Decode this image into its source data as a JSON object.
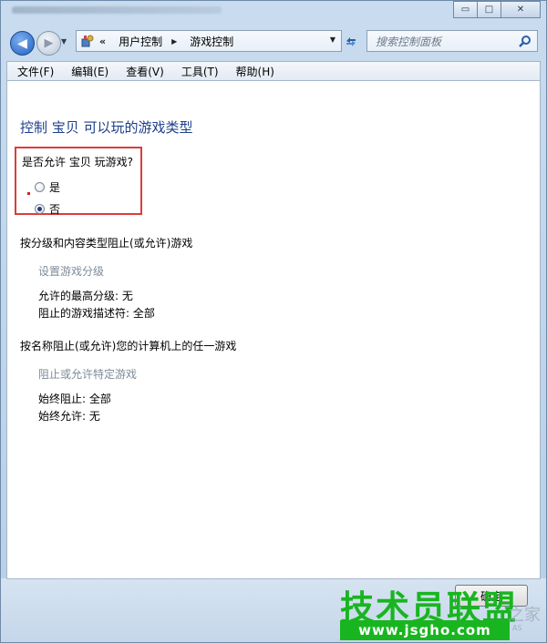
{
  "window": {
    "controls": {
      "minimize": "▭",
      "maximize": "□",
      "close": "✕"
    }
  },
  "nav": {
    "back_glyph": "◀",
    "forward_glyph": "▶",
    "breadcrumb_prefix": "«",
    "breadcrumbs": [
      "用户控制",
      "游戏控制"
    ],
    "search_placeholder": "搜索控制面板"
  },
  "menu": [
    "文件(F)",
    "编辑(E)",
    "查看(V)",
    "工具(T)",
    "帮助(H)"
  ],
  "main": {
    "heading": "控制 宝贝 可以玩的游戏类型",
    "question": "是否允许 宝贝 玩游戏?",
    "options": [
      {
        "label": "是",
        "selected": false
      },
      {
        "label": "否",
        "selected": true
      }
    ],
    "section1": {
      "title": "按分级和内容类型阻止(或允许)游戏",
      "link": "设置游戏分级",
      "info": [
        "允许的最高分级: 无",
        "阻止的游戏描述符: 全部"
      ]
    },
    "section2": {
      "title": "按名称阻止(或允许)您的计算机上的任一游戏",
      "link": "阻止或允许特定游戏",
      "info": [
        "始终阻止: 全部",
        "始终允许: 无"
      ]
    }
  },
  "footer": {
    "ok_label": "确定"
  },
  "watermark": {
    "brand": "技术员联盟",
    "url": "www.jsgho.com",
    "side": "之家",
    "small": "AS"
  },
  "colors": {
    "heading": "#1e3f8a",
    "highlight": "#dc3c3c",
    "link_disabled": "#7e8b99",
    "watermark_green": "#19b520"
  }
}
